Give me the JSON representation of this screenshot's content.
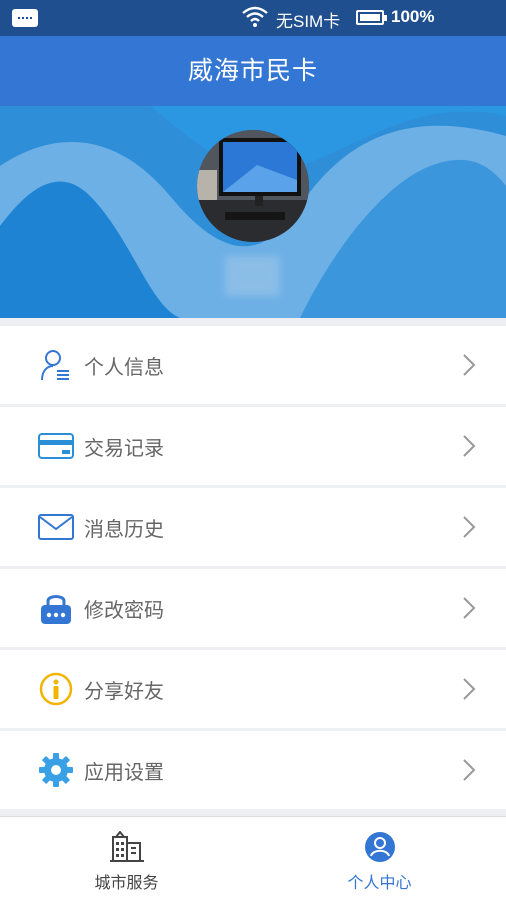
{
  "status_bar": {
    "sim_text": "无SIM卡",
    "battery_percent": "100%"
  },
  "header": {
    "title": "威海市民卡"
  },
  "profile": {
    "avatar": "user-photo"
  },
  "menu": {
    "items": [
      {
        "label": "个人信息",
        "icon": "user-info-icon"
      },
      {
        "label": "交易记录",
        "icon": "card-icon"
      },
      {
        "label": "消息历史",
        "icon": "envelope-icon"
      },
      {
        "label": "修改密码",
        "icon": "lock-icon"
      },
      {
        "label": "分享好友",
        "icon": "info-icon"
      },
      {
        "label": "应用设置",
        "icon": "gear-icon"
      }
    ]
  },
  "tab_bar": {
    "tabs": [
      {
        "label": "城市服务",
        "icon": "city-buildings-icon",
        "active": false
      },
      {
        "label": "个人中心",
        "icon": "person-circle-icon",
        "active": true
      }
    ]
  },
  "colors": {
    "status_bar": "#1f4f8f",
    "header": "#3476d3",
    "active_tab": "#3476d3",
    "inactive_tab": "#444444"
  }
}
